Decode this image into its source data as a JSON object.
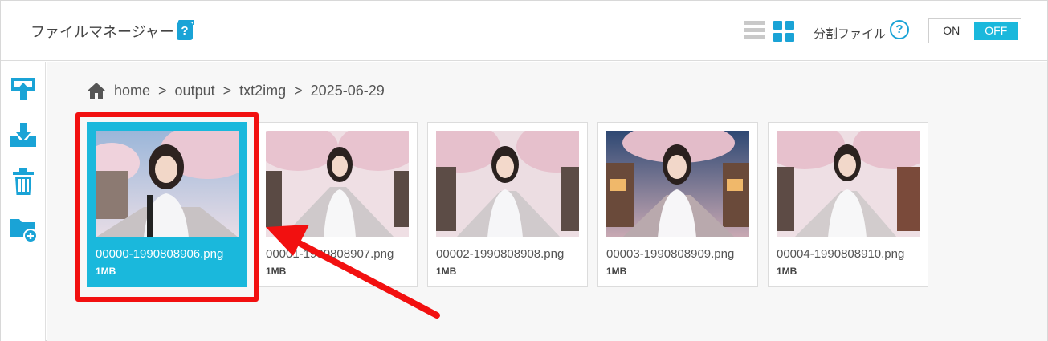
{
  "header": {
    "title": "ファイルマネージャー",
    "help_icon": "book-question-icon",
    "view_modes": [
      "list-view-icon",
      "grid-view-icon"
    ],
    "active_view": "grid",
    "split_label": "分割ファイル",
    "split_help_icon": "question-circle-icon",
    "toggle": {
      "on_label": "ON",
      "off_label": "OFF",
      "selected": "OFF"
    }
  },
  "sidebar": {
    "items": [
      {
        "name": "upload",
        "icon": "upload-icon"
      },
      {
        "name": "download",
        "icon": "download-icon"
      },
      {
        "name": "delete",
        "icon": "trash-icon"
      },
      {
        "name": "new-folder",
        "icon": "folder-add-icon"
      }
    ]
  },
  "breadcrumb": {
    "home_icon": "home-icon",
    "items": [
      "home",
      "output",
      "txt2img",
      "2025-06-29"
    ],
    "separator": ">"
  },
  "files": [
    {
      "name": "00000-1990808906.png",
      "size": "1MB",
      "selected": true
    },
    {
      "name": "00001-1990808907.png",
      "size": "1MB",
      "selected": false
    },
    {
      "name": "00002-1990808908.png",
      "size": "1MB",
      "selected": false
    },
    {
      "name": "00003-1990808909.png",
      "size": "1MB",
      "selected": false
    },
    {
      "name": "00004-1990808910.png",
      "size": "1MB",
      "selected": false
    }
  ],
  "colors": {
    "accent": "#1ab8dc",
    "annotation": "#f21010"
  }
}
